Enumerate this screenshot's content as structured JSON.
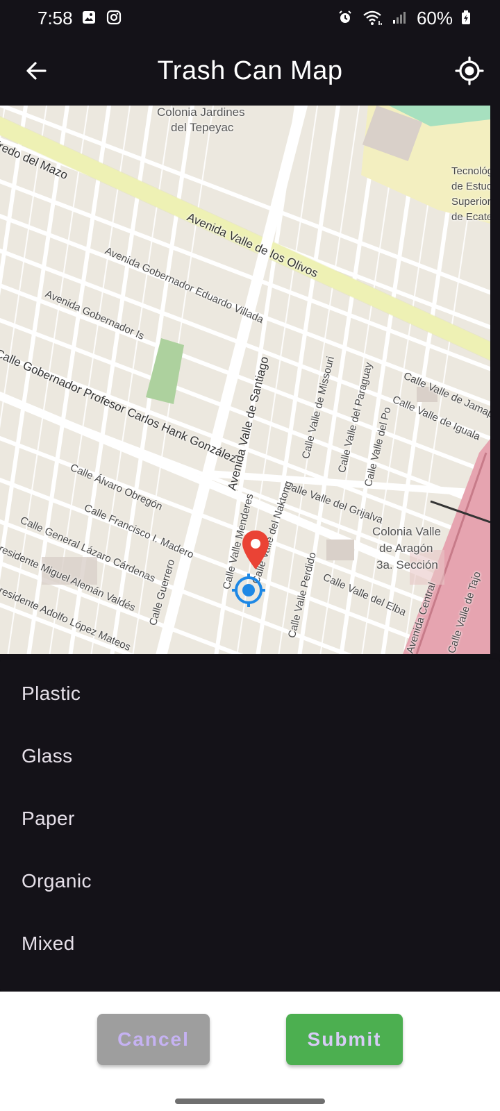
{
  "status_bar": {
    "time": "7:58",
    "battery": "60%",
    "left_icons": [
      "gallery-icon",
      "instagram-icon"
    ],
    "right_icons": [
      "alarm-icon",
      "wifi-icon",
      "signal-icon",
      "battery-icon"
    ]
  },
  "app_bar": {
    "title": "Trash Can Map",
    "back_icon": "arrow-back-icon",
    "action_icon": "my-location-icon"
  },
  "map": {
    "labels": {
      "l1": "Alfredo del Mazo",
      "l2": "Colonia Jardines",
      "l2b": "del Tepeyac",
      "l3": "Avenida Valle de los Olivos",
      "l4": "Avenida Gobernador Eduardo Villada",
      "l5": "Avenida Gobernador Is",
      "l6": "Calle Gobernador Profesor Carlos Hank González",
      "l7": "Avenida Valle de Santiago",
      "l8": "Calle Álvaro Obregón",
      "l9": "Calle Francisco I. Madero",
      "l10": "Calle General Lázaro Cárdenas",
      "l11": "Presidente Miguel Alemán Valdés",
      "l12": "Presidente Adolfo López Mateos",
      "l13": "Calle Valle del Grijalva",
      "l14": "Calle Valle del Elba",
      "l15": "Calle Valle Perdido",
      "l16": "Calle Valle de Jamapa",
      "l17": "Calle Valle de Iguala",
      "l18": "Colonia Valle",
      "l18b": "de Aragón",
      "l18c": "3a. Sección",
      "l19": "Avenida Central",
      "l20": "Tecnológico",
      "l20b": "de Estudios",
      "l20c": "Superiores",
      "l20d": "de Ecatepec",
      "l21": "Calle Valle del Paraguay",
      "l22": "Calle Valle del Po",
      "l23": "Calle Valle de Missouri",
      "l24": "Calle Valle Menderes",
      "l25": "Calle Valle del Naktong",
      "l26": "Calle Guerrero",
      "l27": "Calle Valle de Tajo"
    },
    "marker_icon": "location-pin-icon",
    "current_location_icon": "current-location-icon"
  },
  "menu": {
    "items": [
      "Plastic",
      "Glass",
      "Paper",
      "Organic",
      "Mixed"
    ]
  },
  "actions": {
    "cancel_label": "Cancel",
    "submit_label": "Submit"
  },
  "colors": {
    "background": "#141218",
    "submit": "#4caf50",
    "cancel": "#9e9e9e",
    "marker": "#ea4335",
    "location": "#1e88e5"
  }
}
